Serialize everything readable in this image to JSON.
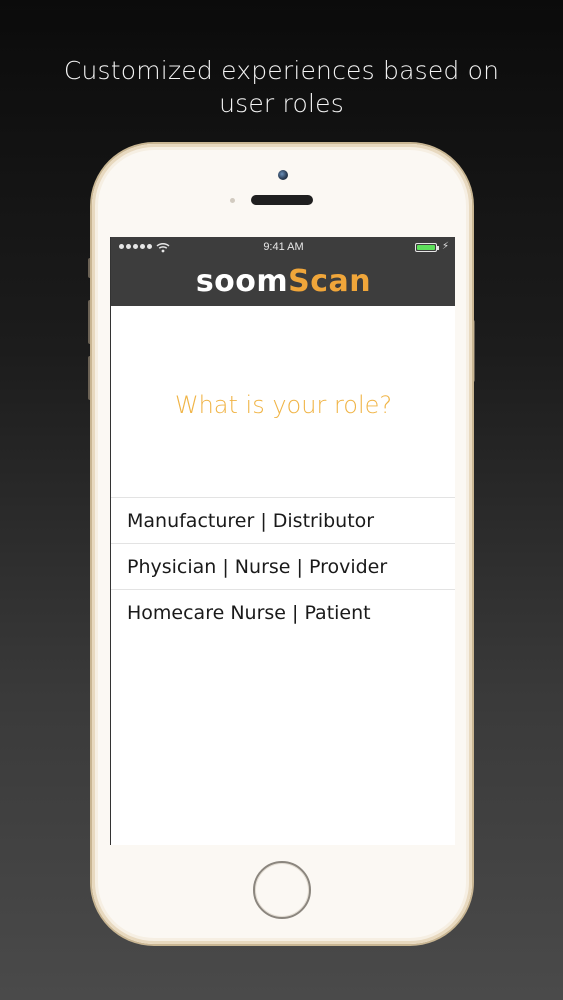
{
  "promo": {
    "line1": "Customized experiences based on",
    "line2": "user roles"
  },
  "status_bar": {
    "time": "9:41 AM",
    "battery_level": 1.0,
    "battery_color": "#5ee05c"
  },
  "app": {
    "logo_part1": "soom",
    "logo_part2": "Scan",
    "logo_color_primary": "#ffffff",
    "logo_color_accent": "#f0a63a",
    "navbar_color": "#3d3d3d"
  },
  "role_screen": {
    "question": "What is your role?",
    "question_color": "#f0b446",
    "options": [
      {
        "label": "Manufacturer | Distributor"
      },
      {
        "label": "Physician | Nurse | Provider"
      },
      {
        "label": "Homecare Nurse | Patient"
      }
    ]
  }
}
